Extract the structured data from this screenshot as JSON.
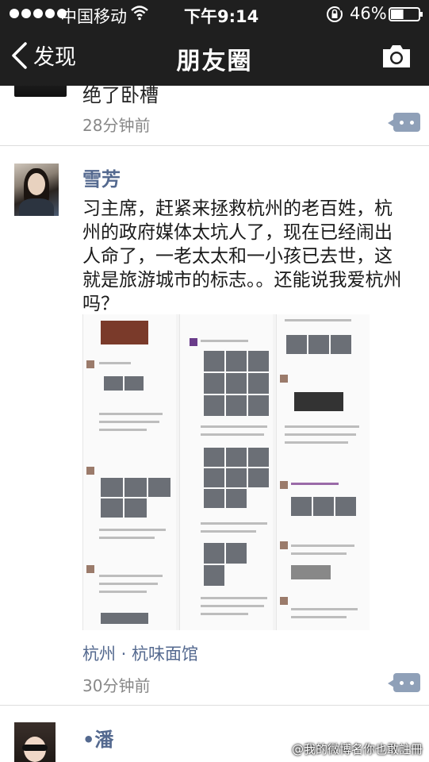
{
  "status_bar": {
    "carrier": "中国移动",
    "time": "下午9:14",
    "battery_percent": "46%",
    "battery_level": 0.46,
    "icons": [
      "signal-dots",
      "wifi-icon",
      "rotation-lock-icon",
      "battery-icon"
    ]
  },
  "nav": {
    "back_label": "发现",
    "title": "朋友圈",
    "icons": [
      "chevron-left-icon",
      "camera-icon"
    ]
  },
  "feed": {
    "previous_post": {
      "text": "绝了卧槽",
      "time": "28分钟前"
    },
    "post": {
      "author": "雪芳",
      "text": "习主席，赶紧来拯救杭州的老百姓，杭州的政府媒体太坑人了，现在已经闹出人命了，一老太太和一小孩已去世，这就是旅游城市的标志。。还能说我爱杭州吗？",
      "location": "杭州 · 杭味面馆",
      "time": "30分钟前"
    },
    "next_post": {
      "author": "•潘"
    }
  },
  "watermark": "@我的微博名你也敢註冊",
  "colors": {
    "header_bg": "#1f1f1f",
    "link_blue": "#54698f",
    "comment_button": "#8fa0b8",
    "timestamp_gray": "#888888"
  }
}
